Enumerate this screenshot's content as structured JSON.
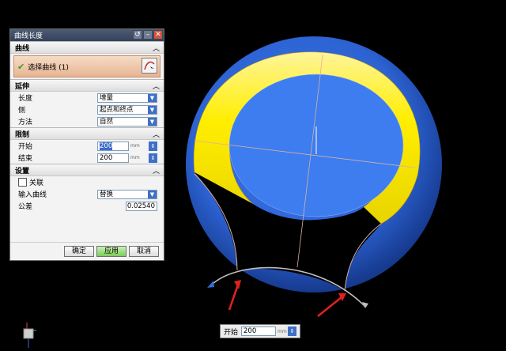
{
  "dialog": {
    "title": "曲线长度",
    "sections": {
      "curve": "曲线",
      "extend": "延伸",
      "limits": "限制",
      "settings": "设置"
    },
    "select_curve_label": "选择曲线 (1)",
    "length_label": "长度",
    "length_value": "增量",
    "side_label": "侧",
    "side_value": "起点和终点",
    "method_label": "方法",
    "method_value": "自然",
    "start_label": "开始",
    "start_value": "200",
    "end_label": "结束",
    "end_value": "200",
    "unit": "mm",
    "associative_label": "关联",
    "input_curve_label": "输入曲线",
    "input_curve_value": "替换",
    "tolerance_label": "公差",
    "tolerance_value": "0.02540",
    "ok_label": "确定",
    "apply_label": "应用",
    "cancel_label": "取消"
  },
  "float_input": {
    "label": "开始",
    "value": "200",
    "unit": "mm"
  },
  "colors": {
    "sphere": "#2f66d8",
    "ring": "#ffee00",
    "background": "#000000",
    "curve": "#d8b0a0",
    "arrow": "#e02020"
  }
}
